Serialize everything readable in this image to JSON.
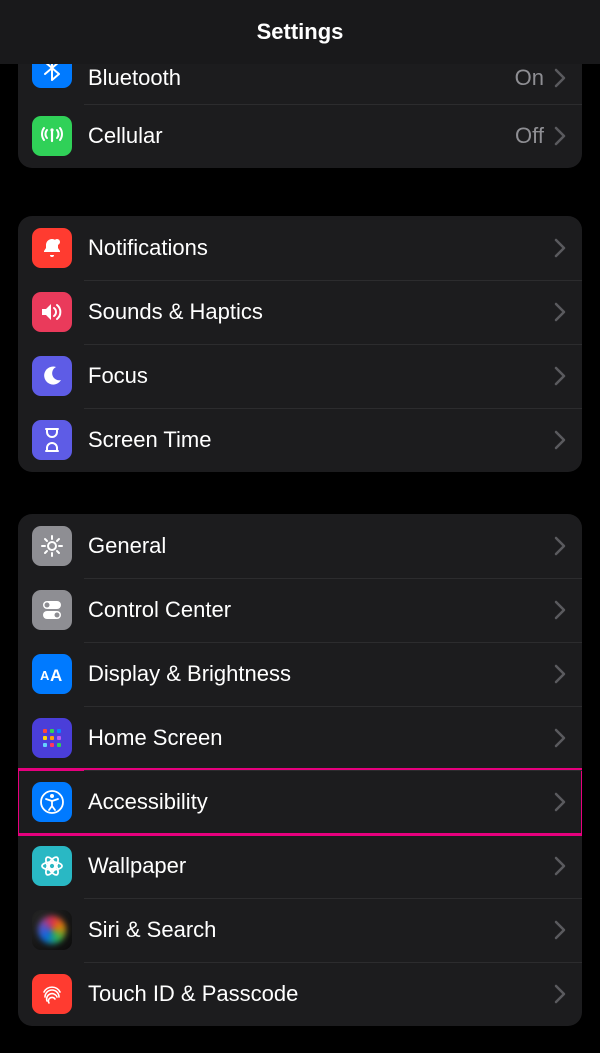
{
  "header": {
    "title": "Settings"
  },
  "group1": {
    "items": [
      {
        "label": "Bluetooth",
        "value": "On"
      },
      {
        "label": "Cellular",
        "value": "Off"
      }
    ]
  },
  "group2": {
    "items": [
      {
        "label": "Notifications"
      },
      {
        "label": "Sounds & Haptics"
      },
      {
        "label": "Focus"
      },
      {
        "label": "Screen Time"
      }
    ]
  },
  "group3": {
    "items": [
      {
        "label": "General"
      },
      {
        "label": "Control Center"
      },
      {
        "label": "Display & Brightness"
      },
      {
        "label": "Home Screen"
      },
      {
        "label": "Accessibility"
      },
      {
        "label": "Wallpaper"
      },
      {
        "label": "Siri & Search"
      },
      {
        "label": "Touch ID & Passcode"
      }
    ]
  },
  "highlight_color": "#e6007e",
  "colors": {
    "bluetooth": "#007aff",
    "cellular": "#30d158",
    "notifications": "#ff3b30",
    "sounds": "#ff3b30",
    "focus": "#5e5ce6",
    "screentime": "#5e5ce6",
    "general": "#8e8e93",
    "controlcenter": "#8e8e93",
    "display": "#007aff",
    "homescreen": "#5e5ce6",
    "accessibility": "#007aff",
    "wallpaper": "#34c7c2",
    "touchid": "#ff3b30"
  }
}
